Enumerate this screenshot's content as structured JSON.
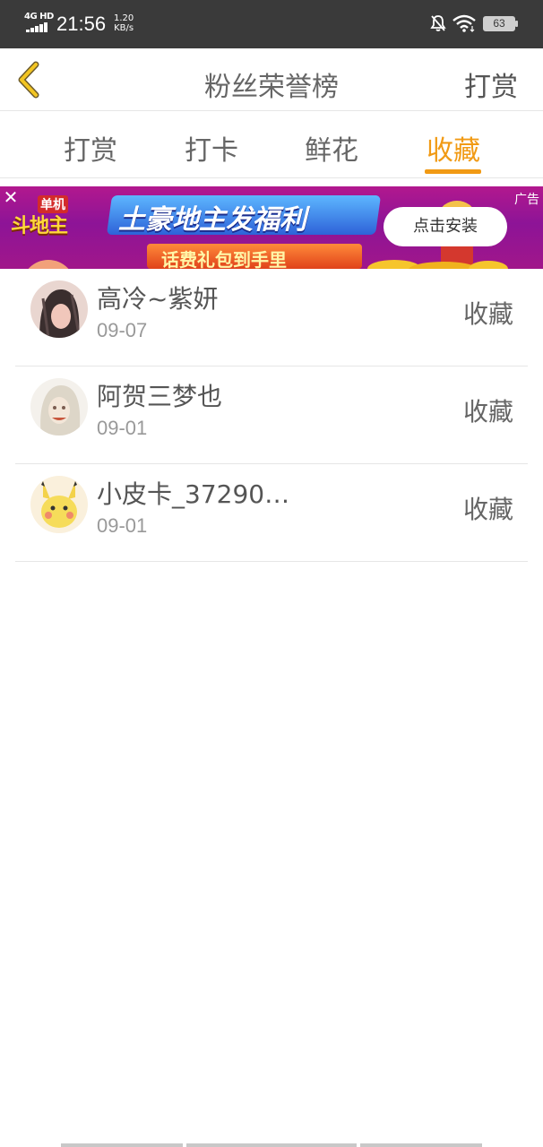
{
  "status_bar": {
    "network": "4G HD",
    "time": "21:56",
    "speed_value": "1.20",
    "speed_unit": "KB/s",
    "battery": "63",
    "icons": [
      "signal-icon",
      "bell-muted-icon",
      "wifi-icon",
      "battery-icon"
    ]
  },
  "header": {
    "back_icon": "chevron-left-icon",
    "title": "粉丝荣誉榜",
    "action": "打赏"
  },
  "tabs": [
    {
      "label": "打赏",
      "active": false
    },
    {
      "label": "打卡",
      "active": false
    },
    {
      "label": "鲜花",
      "active": false
    },
    {
      "label": "收藏",
      "active": true
    }
  ],
  "ad": {
    "logo_small": "单机",
    "logo_big": "斗地主",
    "slogan": "土豪地主发福利",
    "sub": "话费礼包到手里",
    "cta": "点击安装",
    "tag": "广告",
    "close_icon": "close-icon"
  },
  "list": [
    {
      "name": "高冷~紫妍",
      "date": "09-07",
      "action": "收藏"
    },
    {
      "name": "阿贺三梦也",
      "date": "09-01",
      "action": "收藏"
    },
    {
      "name": "小皮卡_37290…",
      "date": "09-01",
      "action": "收藏"
    }
  ],
  "colors": {
    "accent": "#f19a14",
    "status_bar": "#3a3a3a",
    "divider": "#e6e6e6"
  }
}
